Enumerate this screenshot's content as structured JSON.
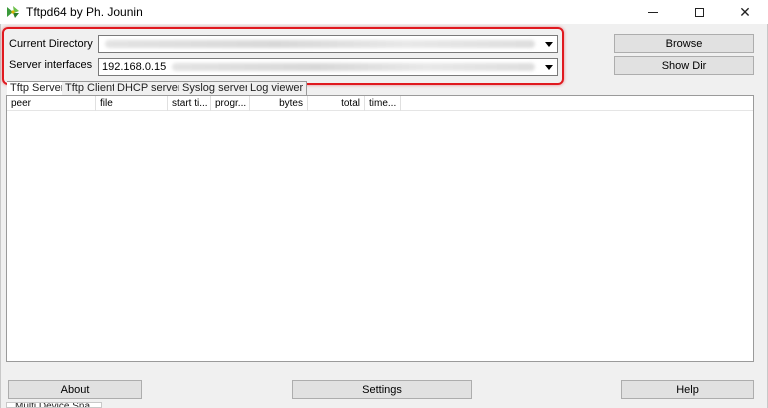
{
  "window": {
    "title": "Tftpd64 by Ph. Jounin"
  },
  "form": {
    "current_directory_label": "Current Directory",
    "server_interfaces_label": "Server interfaces",
    "server_interfaces_value": "192.168.0.15"
  },
  "buttons": {
    "browse": "Browse",
    "show_dir": "Show Dir",
    "about": "About",
    "settings": "Settings",
    "help": "Help"
  },
  "tabs": [
    {
      "label": "Tftp Server",
      "active": true
    },
    {
      "label": "Tftp Client"
    },
    {
      "label": "DHCP server"
    },
    {
      "label": "Syslog server"
    },
    {
      "label": "Log viewer"
    }
  ],
  "table": {
    "columns": [
      "peer",
      "file",
      "start ti...",
      "progr...",
      "bytes",
      "total",
      "time..."
    ]
  },
  "background": {
    "partial_window_text": "Multi Device Sna"
  },
  "colors": {
    "highlight": "#e0191f",
    "window_bg": "#f0f0f0"
  },
  "icons": {
    "app": "tftpd-app-icon",
    "minimize": "minimize-icon",
    "maximize": "maximize-icon",
    "close": "close-icon",
    "dropdown": "chevron-down-icon"
  }
}
